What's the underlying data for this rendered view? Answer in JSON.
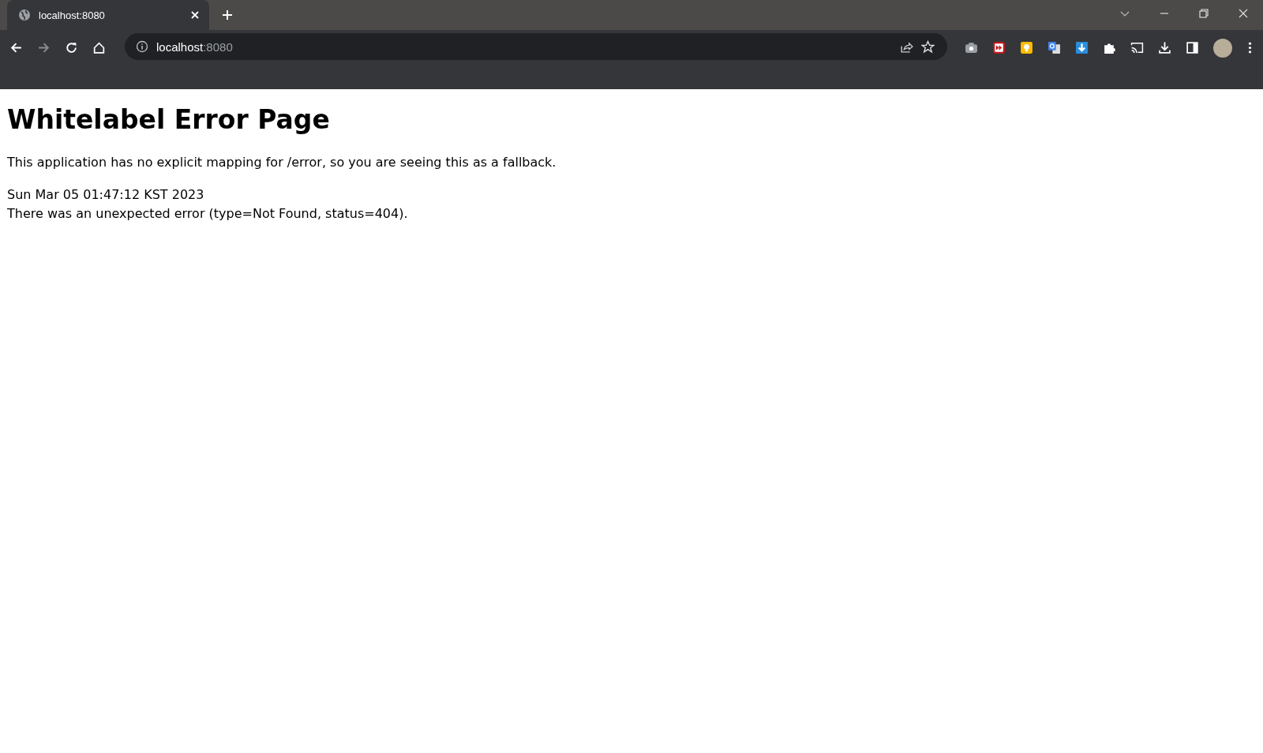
{
  "tabs": [
    {
      "title": "localhost:8080",
      "selected": true
    }
  ],
  "address": {
    "host": "localhost",
    "port": ":8080"
  },
  "page": {
    "heading": "Whitelabel Error Page",
    "message": "This application has no explicit mapping for /error, so you are seeing this as a fallback.",
    "timestamp": "Sun Mar 05 01:47:12 KST 2023",
    "error": "There was an unexpected error (type=Not Found, status=404)."
  }
}
